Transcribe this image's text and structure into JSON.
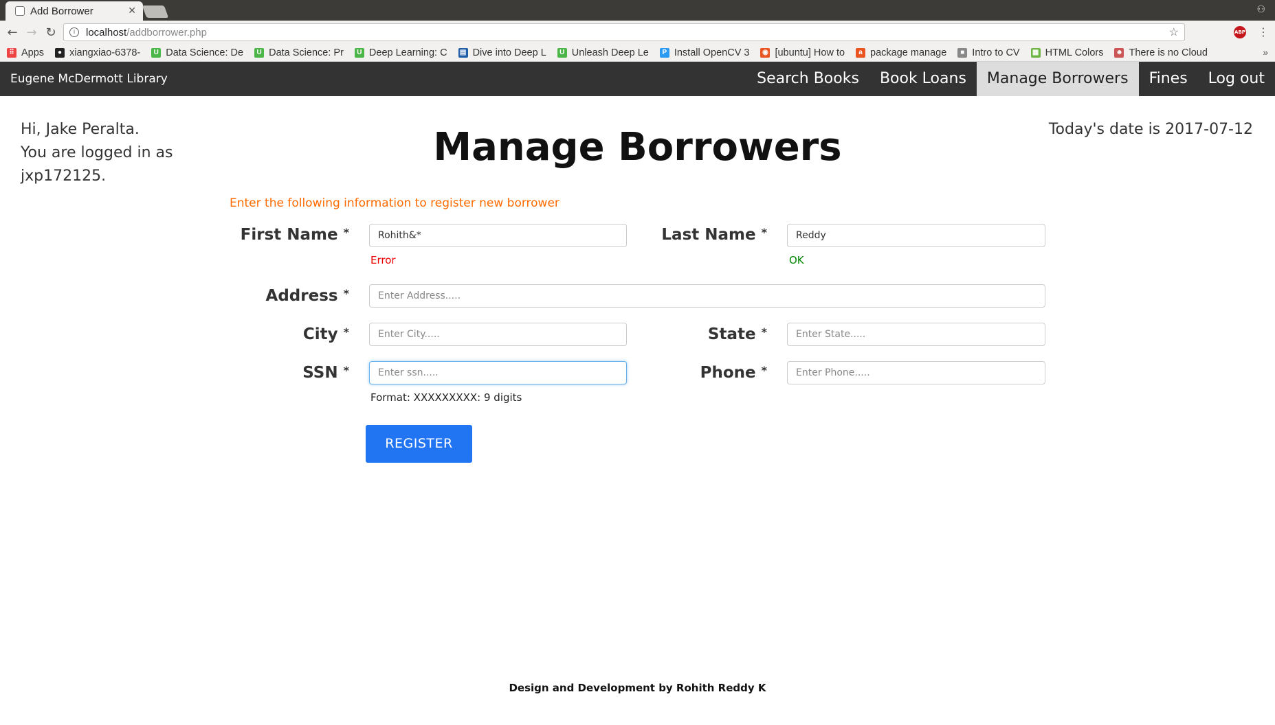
{
  "browser": {
    "tab_title": "Add Borrower",
    "url_host": "localhost",
    "url_path": "/addborrower.php",
    "bookmarks": [
      {
        "label": "Apps",
        "icon": "apps-grid-icon",
        "color": "#e44"
      },
      {
        "label": "xiangxiao-6378-",
        "icon": "github-icon",
        "color": "#222"
      },
      {
        "label": "Data Science: De",
        "icon": "udacity-icon",
        "color": "#4cb648"
      },
      {
        "label": "Data Science: Pr",
        "icon": "udacity-icon",
        "color": "#4cb648"
      },
      {
        "label": "Deep Learning: C",
        "icon": "udacity-icon",
        "color": "#4cb648"
      },
      {
        "label": "Dive into Deep L",
        "icon": "book-icon",
        "color": "#1f5fa8"
      },
      {
        "label": "Unleash Deep Le",
        "icon": "udacity-icon",
        "color": "#4cb648"
      },
      {
        "label": "Install OpenCV 3",
        "icon": "p-circle-icon",
        "color": "#2b9af3"
      },
      {
        "label": "[ubuntu] How to",
        "icon": "ubuntu-icon",
        "color": "#e95420"
      },
      {
        "label": "package manage",
        "icon": "askubuntu-icon",
        "color": "#e95420"
      },
      {
        "label": "Intro to CV",
        "icon": "folder-icon",
        "color": "#888"
      },
      {
        "label": "HTML Colors",
        "icon": "color-swatch-icon",
        "color": "#6bb543"
      },
      {
        "label": "There is no Cloud",
        "icon": "mascot-icon",
        "color": "#c55"
      }
    ]
  },
  "navbar": {
    "brand": "Eugene McDermott Library",
    "links": [
      "Search Books",
      "Book Loans",
      "Manage Borrowers",
      "Fines",
      "Log out"
    ],
    "active": "Manage Borrowers"
  },
  "greeting": {
    "line1": "Hi, Jake Peralta.",
    "line2": "You are logged in as",
    "line3": "jxp172125."
  },
  "today": "Today's date is 2017-07-12",
  "page_title": "Manage Borrowers",
  "instructions": "Enter the following information to register new borrower",
  "form": {
    "first_name": {
      "label": "First Name",
      "value": "Rohith&*",
      "status": "Error"
    },
    "last_name": {
      "label": "Last Name",
      "value": "Reddy",
      "status": "OK"
    },
    "address": {
      "label": "Address",
      "placeholder": "Enter Address....."
    },
    "city": {
      "label": "City",
      "placeholder": "Enter City....."
    },
    "state": {
      "label": "State",
      "placeholder": "Enter State....."
    },
    "ssn": {
      "label": "SSN",
      "placeholder": "Enter ssn.....",
      "hint": "Format: XXXXXXXXX: 9 digits"
    },
    "phone": {
      "label": "Phone",
      "placeholder": "Enter Phone....."
    },
    "required_mark": "*",
    "register_label": "REGISTER"
  },
  "footer": "Design and Development by Rohith Reddy K",
  "colors": {
    "accent": "#2175f3",
    "instruction": "#ff6a00",
    "error": "#e00000",
    "ok": "#008000",
    "navbar": "#333333"
  }
}
